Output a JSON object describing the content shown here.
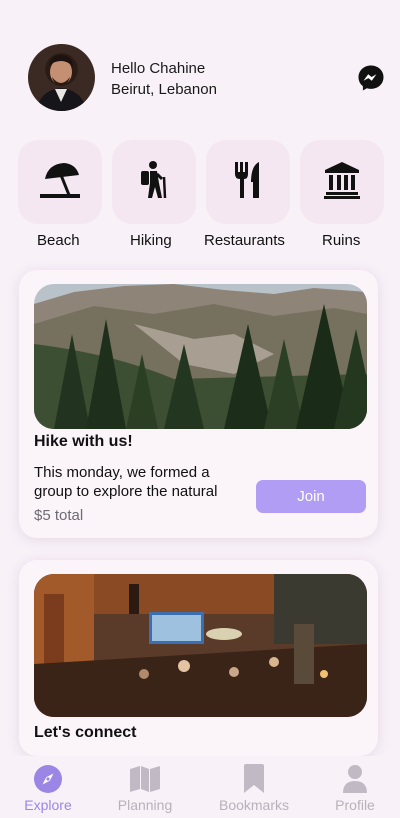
{
  "header": {
    "greeting": "Hello Chahine",
    "location": "Beirut, Lebanon",
    "messenger_icon": "messenger-icon"
  },
  "categories": [
    {
      "label": "Beach",
      "icon": "beach-umbrella-icon"
    },
    {
      "label": "Hiking",
      "icon": "hiker-icon"
    },
    {
      "label": "Restaurants",
      "icon": "utensils-icon"
    },
    {
      "label": "Ruins",
      "icon": "landmark-icon"
    }
  ],
  "feed": [
    {
      "title": "Hike with us!",
      "description": "This monday, we formed a group to explore the natural",
      "price": "$5 total",
      "join_label": "Join"
    },
    {
      "title": "Let's connect"
    }
  ],
  "tabbar": {
    "tabs": [
      {
        "label": "Explore",
        "icon": "compass-icon",
        "active": true
      },
      {
        "label": "Planning",
        "icon": "map-icon",
        "active": false
      },
      {
        "label": "Bookmarks",
        "icon": "bookmark-icon",
        "active": false
      },
      {
        "label": "Profile",
        "icon": "person-icon",
        "active": false
      }
    ]
  },
  "colors": {
    "background": "#f8f1f8",
    "category_tile": "#f4e7f2",
    "accent": "#b19df3",
    "active_tab": "#9b86e6",
    "inactive_tab": "#b8b1bb"
  }
}
